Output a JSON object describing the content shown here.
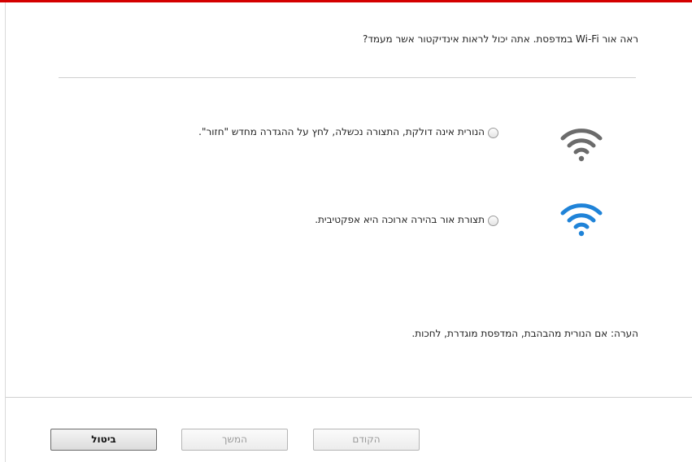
{
  "dialog": {
    "question": "ראה אור Wi-Fi במדפסת. אתה יכול לראות אינדיקטור אשר מעמד?",
    "note": "הערה: אם הנורית מהבהבת, המדפסת מוגדרת, לחכות."
  },
  "options": [
    {
      "label": "הנורית אינה דולקת, התצורה נכשלה, לחץ על ההגדרה מחדש \"חזור\".",
      "icon": "wifi-gray-icon",
      "icon_color": "#6b6b6b"
    },
    {
      "label": "תצורת אור בהירה ארוכה היא אפקטיבית.",
      "icon": "wifi-blue-icon",
      "icon_color": "#1f83d8"
    }
  ],
  "buttons": {
    "back": "הקודם",
    "next": "המשך",
    "cancel": "ביטול"
  },
  "colors": {
    "accent_bar": "#d40000"
  }
}
